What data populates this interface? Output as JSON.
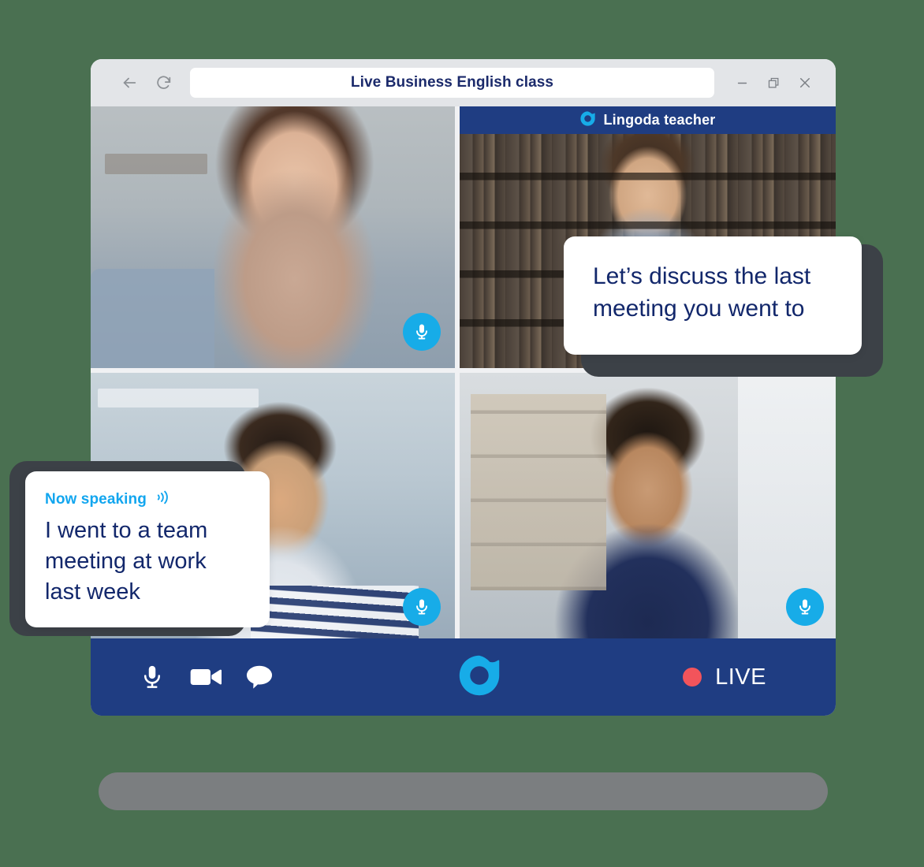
{
  "theme": {
    "page_background": "#4a7051",
    "brand_navy": "#1f3d82",
    "brand_blue": "#17ace8",
    "text_navy": "#12276b",
    "live_red": "#f2545b",
    "card_shadow": "#3c4147",
    "laptop_base": "#7b7e80"
  },
  "window": {
    "title": "Live Business English class",
    "back_icon": "back-arrow-icon",
    "reload_icon": "reload-icon",
    "minimize_icon": "minimize-icon",
    "restore_icon": "restore-icon",
    "close_icon": "close-icon"
  },
  "call": {
    "teacher_banner": {
      "logo_icon": "lingoda-logo-icon",
      "label": "Lingoda teacher"
    },
    "participants": [
      {
        "position": "top-left",
        "mic_icon": "microphone-icon",
        "mic_on": true
      },
      {
        "position": "top-right",
        "mic_icon": "microphone-icon",
        "mic_on": false
      },
      {
        "position": "bottom-left",
        "mic_icon": "microphone-icon",
        "mic_on": true
      },
      {
        "position": "bottom-right",
        "mic_icon": "microphone-icon",
        "mic_on": true
      }
    ]
  },
  "bubbles": {
    "teacher": {
      "lines": [
        "Let’s discuss the last",
        "meeting you went to"
      ]
    },
    "student": {
      "status_label": "Now speaking",
      "status_icon": "sound-wave-icon",
      "lines": [
        "I went to a team",
        "meeting at work",
        "last week"
      ]
    }
  },
  "controls": {
    "microphone_icon": "microphone-icon",
    "camera_icon": "video-camera-icon",
    "chat_icon": "chat-bubble-icon",
    "brand_logo_icon": "lingoda-logo-icon",
    "live_label": "LIVE",
    "live_dot_icon": "record-dot-icon"
  }
}
